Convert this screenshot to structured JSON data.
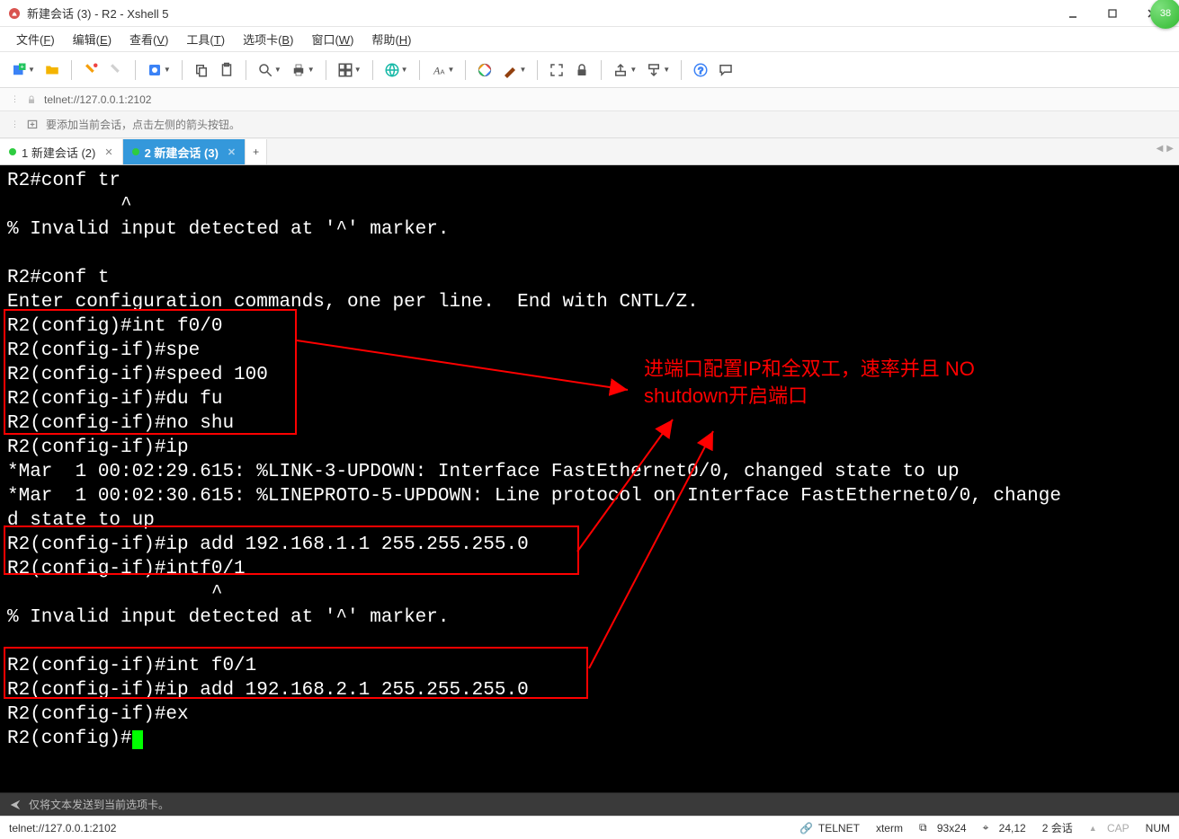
{
  "window": {
    "title": "新建会话 (3) - R2 - Xshell 5"
  },
  "badge": {
    "value": "38"
  },
  "menu": {
    "file": {
      "label": "文件",
      "key": "F"
    },
    "edit": {
      "label": "编辑",
      "key": "E"
    },
    "view": {
      "label": "查看",
      "key": "V"
    },
    "tools": {
      "label": "工具",
      "key": "T"
    },
    "tabs": {
      "label": "选项卡",
      "key": "B"
    },
    "window": {
      "label": "窗口",
      "key": "W"
    },
    "help": {
      "label": "帮助",
      "key": "H"
    }
  },
  "address": {
    "url": "telnet://127.0.0.1:2102"
  },
  "hint": {
    "text": "要添加当前会话，点击左侧的箭头按钮。"
  },
  "tabs": [
    {
      "dot": "#2ecc40",
      "label": "1 新建会话 (2)",
      "active": false
    },
    {
      "dot": "#2ecc40",
      "label": "2 新建会话 (3)",
      "active": true
    }
  ],
  "plus": "+",
  "terminal": {
    "lines": [
      "R2#conf tr",
      "          ^",
      "% Invalid input detected at '^' marker.",
      "",
      "R2#conf t",
      "Enter configuration commands, one per line.  End with CNTL/Z.",
      "R2(config)#int f0/0",
      "R2(config-if)#spe",
      "R2(config-if)#speed 100",
      "R2(config-if)#du fu",
      "R2(config-if)#no shu",
      "R2(config-if)#ip",
      "*Mar  1 00:02:29.615: %LINK-3-UPDOWN: Interface FastEthernet0/0, changed state to up",
      "*Mar  1 00:02:30.615: %LINEPROTO-5-UPDOWN: Line protocol on Interface FastEthernet0/0, change",
      "d state to up",
      "R2(config-if)#ip add 192.168.1.1 255.255.255.0",
      "R2(config-if)#intf0/1",
      "                  ^",
      "% Invalid input detected at '^' marker.",
      "",
      "R2(config-if)#int f0/1",
      "R2(config-if)#ip add 192.168.2.1 255.255.255.0",
      "R2(config-if)#ex",
      "R2(config)#"
    ]
  },
  "annotation": {
    "line1": "进端口配置IP和全双工，速率并且 NO",
    "line2": "shutdown开启端口"
  },
  "inputbar": {
    "placeholder": "仅将文本发送到当前选项卡。"
  },
  "status": {
    "left": "telnet://127.0.0.1:2102",
    "proto": "TELNET",
    "term": "xterm",
    "size": "93x24",
    "pos": "24,12",
    "sess": "2 会话",
    "cap": "CAP",
    "num": "NUM",
    "size_icon": "⧉",
    "pos_icon": "⌖",
    "link_icon": "🔗"
  }
}
